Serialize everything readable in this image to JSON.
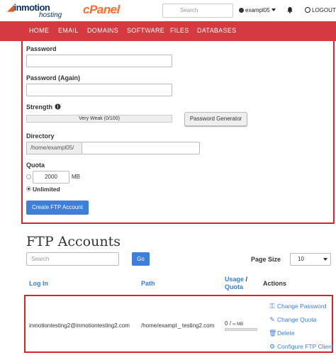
{
  "topbar": {
    "brand_line1": "inmotion",
    "brand_line2": "hosting",
    "cpanel": "cPanel",
    "search_placeholder": "Search",
    "user": "exampl05",
    "logout": "LOGOUT"
  },
  "nav": {
    "items": [
      "HOME",
      "EMAIL",
      "DOMAINS",
      "SOFTWARE",
      "FILES",
      "DATABASES"
    ]
  },
  "form": {
    "password_label": "Password",
    "password_again_label": "Password (Again)",
    "strength_label": "Strength",
    "strength_value": "Very Weak (0/100)",
    "generator_button": "Password Generator",
    "directory_label": "Directory",
    "directory_prefix": "/home/exampl05/",
    "quota_label": "Quota",
    "quota_value": "2000",
    "quota_unit": "MB",
    "unlimited_label": "Unlimited",
    "create_button": "Create FTP Account"
  },
  "accounts": {
    "heading": "FTP Accounts",
    "search_placeholder": "Search",
    "go_button": "Go",
    "page_size_label": "Page Size",
    "page_size_value": "10",
    "columns": {
      "login": "Log In",
      "path": "Path",
      "usage_line1": "Usage",
      "usage_sep": "/",
      "usage_line2": "Quota",
      "actions": "Actions"
    },
    "rows": [
      {
        "login": "inmotiontesting2@inmotiontesting2.com",
        "path": "/home/exampl _ testing2.com",
        "usage": "0",
        "usage_sep": "/",
        "quota": "∞ MB",
        "actions": [
          "Change Password",
          "Change Quota",
          "Delete",
          "Configure FTP Client"
        ]
      }
    ]
  },
  "colors": {
    "nav_red": "#d43a3f",
    "highlight_red": "#d9232b",
    "primary_blue": "#3d7fd9"
  }
}
